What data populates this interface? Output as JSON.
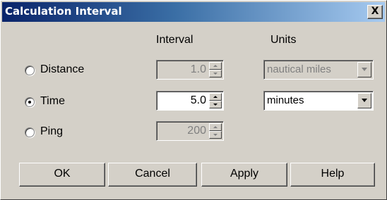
{
  "window": {
    "title": "Calculation Interval",
    "close_glyph": "X",
    "colors": {
      "face": "#d4d0c8",
      "title_start": "#0a246a",
      "title_end": "#a6caf0",
      "disabled_text": "#808080"
    }
  },
  "headers": {
    "interval": "Interval",
    "units": "Units"
  },
  "rows": [
    {
      "label": "Distance",
      "selected": false,
      "interval": "1.0",
      "interval_enabled": false,
      "units": "nautical miles",
      "units_enabled": false
    },
    {
      "label": "Time",
      "selected": true,
      "interval": "5.0",
      "interval_enabled": true,
      "units": "minutes",
      "units_enabled": true
    },
    {
      "label": "Ping",
      "selected": false,
      "interval": "200",
      "interval_enabled": false
    }
  ],
  "buttons": {
    "ok": "OK",
    "cancel": "Cancel",
    "apply": "Apply",
    "help": "Help"
  },
  "icons": {
    "close": "close-icon",
    "spin_up": "spin-up-arrow-icon",
    "spin_down": "spin-down-arrow-icon",
    "dropdown": "chevron-down-icon"
  }
}
